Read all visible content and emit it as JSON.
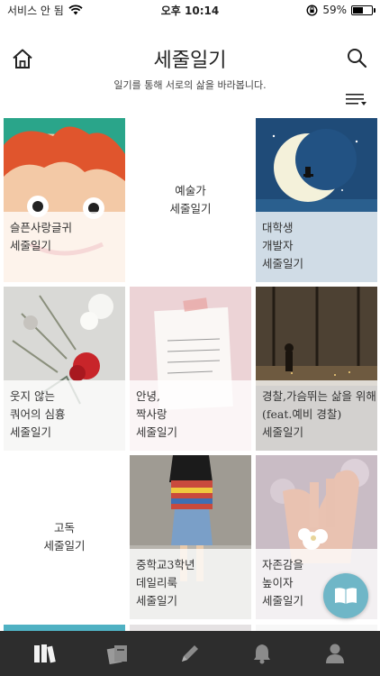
{
  "status_bar": {
    "carrier": "서비스 안 됨",
    "time": "오후 10:14",
    "battery": "59%",
    "battery_level": 0.59
  },
  "header": {
    "title": "세줄일기",
    "subtitle": "일기를 통해 서로의 삶을 바라봅니다."
  },
  "icons": {
    "home": "home-icon",
    "search": "search-icon",
    "sort": "sort-menu-icon",
    "fab": "book-icon",
    "tabs": [
      "bookshelf-icon",
      "books-icon",
      "pencil-icon",
      "bell-icon",
      "person-icon"
    ]
  },
  "tiles": [
    {
      "lines": [
        "슬픈사랑글귀",
        "세줄일기"
      ],
      "art": "cartoon"
    },
    {
      "lines": [
        "예술가",
        "세줄일기"
      ],
      "art": "plain"
    },
    {
      "lines": [
        "대학생",
        "개발자",
        "세줄일기"
      ],
      "art": "moon"
    },
    {
      "lines": [
        "웃지 않는",
        "쿼어의 심흉",
        "세줄일기"
      ],
      "art": "flowers"
    },
    {
      "lines": [
        "안녕,",
        "짝사랑",
        "세줄일기"
      ],
      "art": "note"
    },
    {
      "lines": [
        "경찰,가슴뛰는 삶을 위해",
        "(feat.예비 경찰)",
        "세줄일기"
      ],
      "art": "city"
    },
    {
      "lines": [
        "고독",
        "세줄일기"
      ],
      "art": "plain"
    },
    {
      "lines": [
        "중학교3학년",
        "데일리룩",
        "세줄일기"
      ],
      "art": "girl"
    },
    {
      "lines": [
        "자존감을",
        "높이자",
        "세줄일기"
      ],
      "art": "hand"
    }
  ],
  "colors": {
    "tab_bar": "#2d2d2d",
    "fab": "#6fb6c7"
  }
}
